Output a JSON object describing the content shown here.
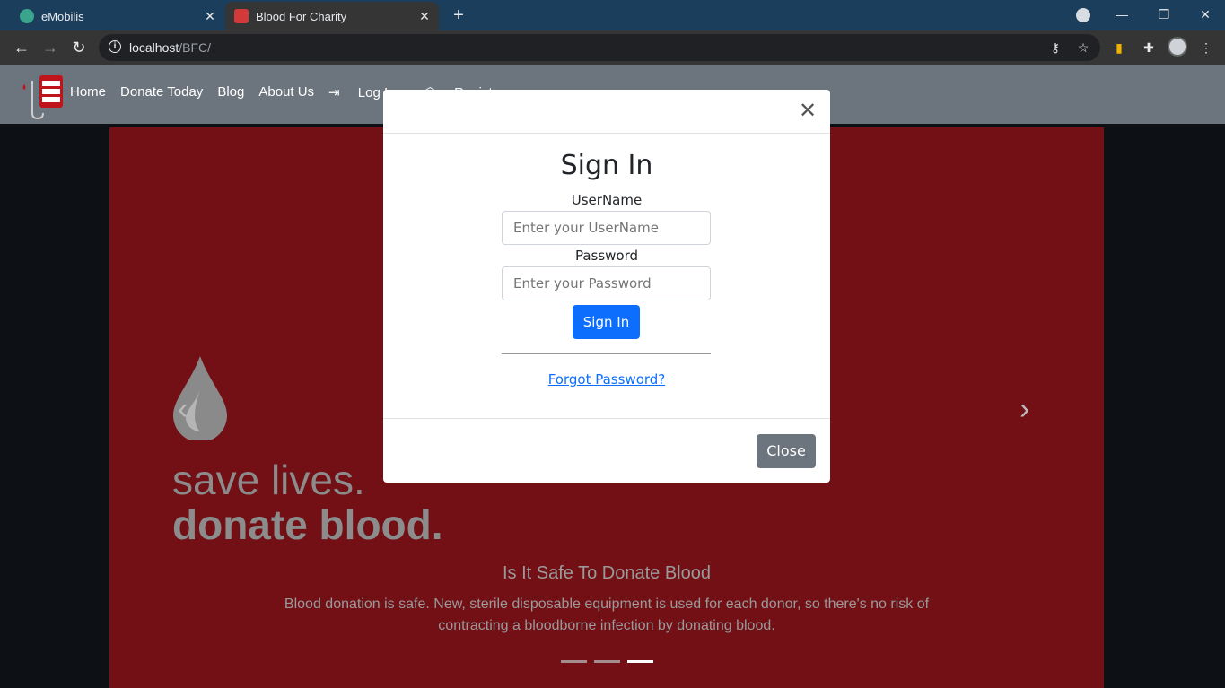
{
  "browser": {
    "tabs": [
      {
        "title": "eMobilis",
        "favicon_color": "#3aa58c"
      },
      {
        "title": "Blood For Charity",
        "favicon_color": "#d23a3a"
      }
    ],
    "url_host": "localhost",
    "url_path": "/BFC/"
  },
  "nav": {
    "links": [
      "Home",
      "Donate Today",
      "Blog",
      "About Us",
      "Log In",
      "Register"
    ]
  },
  "hero": {
    "line1": "save lives.",
    "line2": "donate blood.",
    "caption_title": "Is It Safe To Donate Blood",
    "caption_text": "Blood donation is safe. New, sterile disposable equipment is used for each donor, so there's no risk of contracting a bloodborne infection by donating blood.",
    "active_slide": 3,
    "slide_count": 3
  },
  "modal": {
    "title": "Sign In",
    "username_label": "UserName",
    "username_placeholder": "Enter your UserName",
    "password_label": "Password",
    "password_placeholder": "Enter your Password",
    "signin_button": "Sign In",
    "forgot_link": "Forgot Password?",
    "close_button": "Close"
  },
  "colors": {
    "navbar": "#6c757d",
    "carousel": "#721016",
    "primary": "#0d6efd"
  }
}
